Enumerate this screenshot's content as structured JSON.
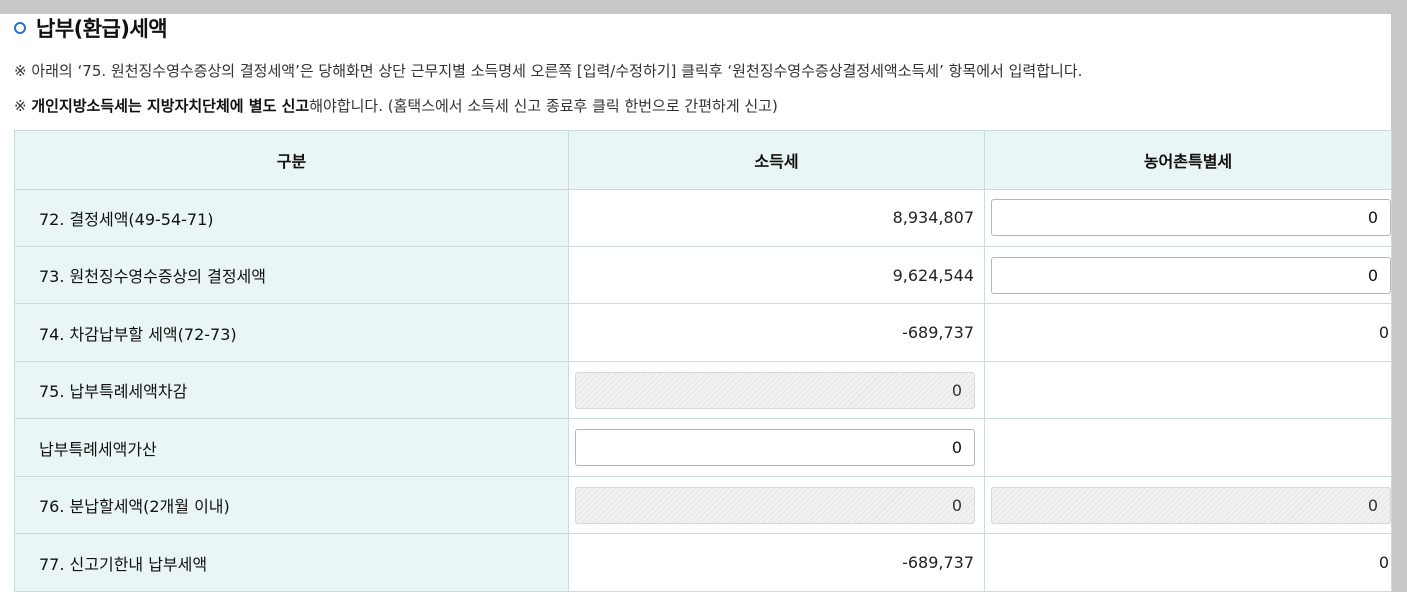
{
  "section": {
    "title": "납부(환급)세액",
    "note1": "※ 아래의 ‘75. 원천징수영수증상의 결정세액’은 당해화면 상단 근무지별 소득명세 오른쪽 [입력/수정하기] 클릭후 ‘원천징수영수증상결정세액소득세’ 항목에서 입력합니다.",
    "note2_prefix": "※ ",
    "note2_bold": "개인지방소득세는 지방자치단체에 별도 신고",
    "note2_rest": "해야합니다. (홈택스에서 소득세 신고 종료후 클릭 한번으로 간편하게 신고)"
  },
  "table": {
    "headers": [
      "구분",
      "소득세",
      "농어촌특별세"
    ],
    "rows": [
      {
        "label": "72. 결정세액(49-54-71)",
        "income_tax": "8,934,807",
        "rural_tax": "0"
      },
      {
        "label": "73. 원천징수영수증상의 결정세액",
        "income_tax": "9,624,544",
        "rural_tax": "0"
      },
      {
        "label": "74. 차감납부할 세액(72-73)",
        "income_tax": "-689,737",
        "rural_tax": "0"
      },
      {
        "label": "75. 납부특례세액차감",
        "income_tax": "0",
        "rural_tax": ""
      },
      {
        "label": "납부특례세액가산",
        "income_tax": "0",
        "rural_tax": ""
      },
      {
        "label": "76. 분납할세액(2개월 이내)",
        "income_tax": "0",
        "rural_tax": "0"
      },
      {
        "label": "77. 신고기한내 납부세액",
        "income_tax": "-689,737",
        "rural_tax": "0"
      }
    ]
  },
  "colors": {
    "accent": "#2d6fd6",
    "header_bg": "#e9f6f5",
    "border": "#c9dcdc"
  }
}
